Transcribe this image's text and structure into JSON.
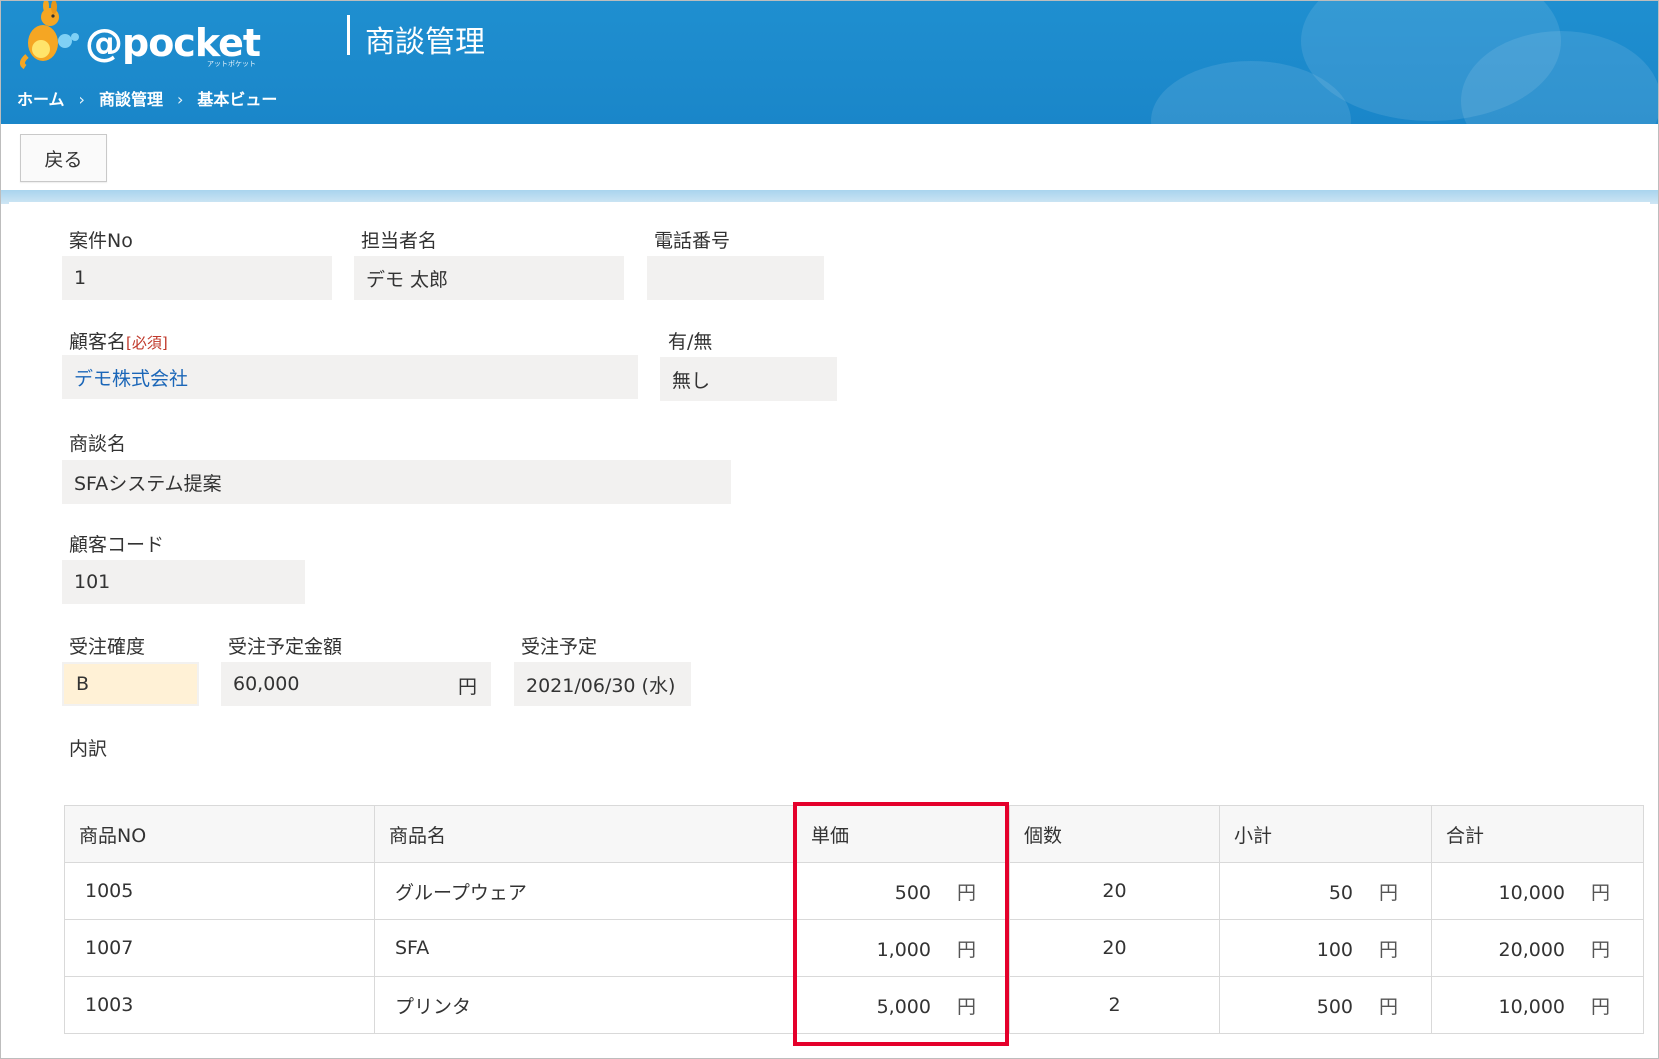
{
  "header": {
    "logo_text": "@pocket",
    "logo_sub": "アットポケット",
    "app_title": "商談管理",
    "breadcrumb": [
      "ホーム",
      "商談管理",
      "基本ビュー"
    ],
    "bg_color": "#1a86c9"
  },
  "toolbar": {
    "back_label": "戻る"
  },
  "form": {
    "case_no": {
      "label": "案件No",
      "value": "1"
    },
    "owner": {
      "label": "担当者名",
      "value": "デモ 太郎"
    },
    "phone": {
      "label": "電話番号",
      "value": ""
    },
    "customer": {
      "label": "顧客名",
      "required": "[必須]",
      "value": "デモ株式会社"
    },
    "presence": {
      "label": "有/無",
      "value": "無し"
    },
    "deal_name": {
      "label": "商談名",
      "value": "SFAシステム提案"
    },
    "customer_code": {
      "label": "顧客コード",
      "value": "101"
    },
    "probability": {
      "label": "受注確度",
      "value": "B"
    },
    "amount": {
      "label": "受注予定金額",
      "value": "60,000",
      "unit": "円"
    },
    "order_date": {
      "label": "受注予定",
      "value": "2021/06/30 (水)"
    }
  },
  "breakdown": {
    "label": "内訳",
    "columns": [
      "商品NO",
      "商品名",
      "単価",
      "個数",
      "小計",
      "合計"
    ],
    "unit": "円",
    "rows": [
      {
        "no": "1005",
        "name": "グループウェア",
        "price": "500",
        "qty": "20",
        "subtotal": "50",
        "total": "10,000"
      },
      {
        "no": "1007",
        "name": "SFA",
        "price": "1,000",
        "qty": "20",
        "subtotal": "100",
        "total": "20,000"
      },
      {
        "no": "1003",
        "name": "プリンタ",
        "price": "5,000",
        "qty": "2",
        "subtotal": "500",
        "total": "10,000"
      }
    ]
  },
  "highlight_color": "#e4002b"
}
